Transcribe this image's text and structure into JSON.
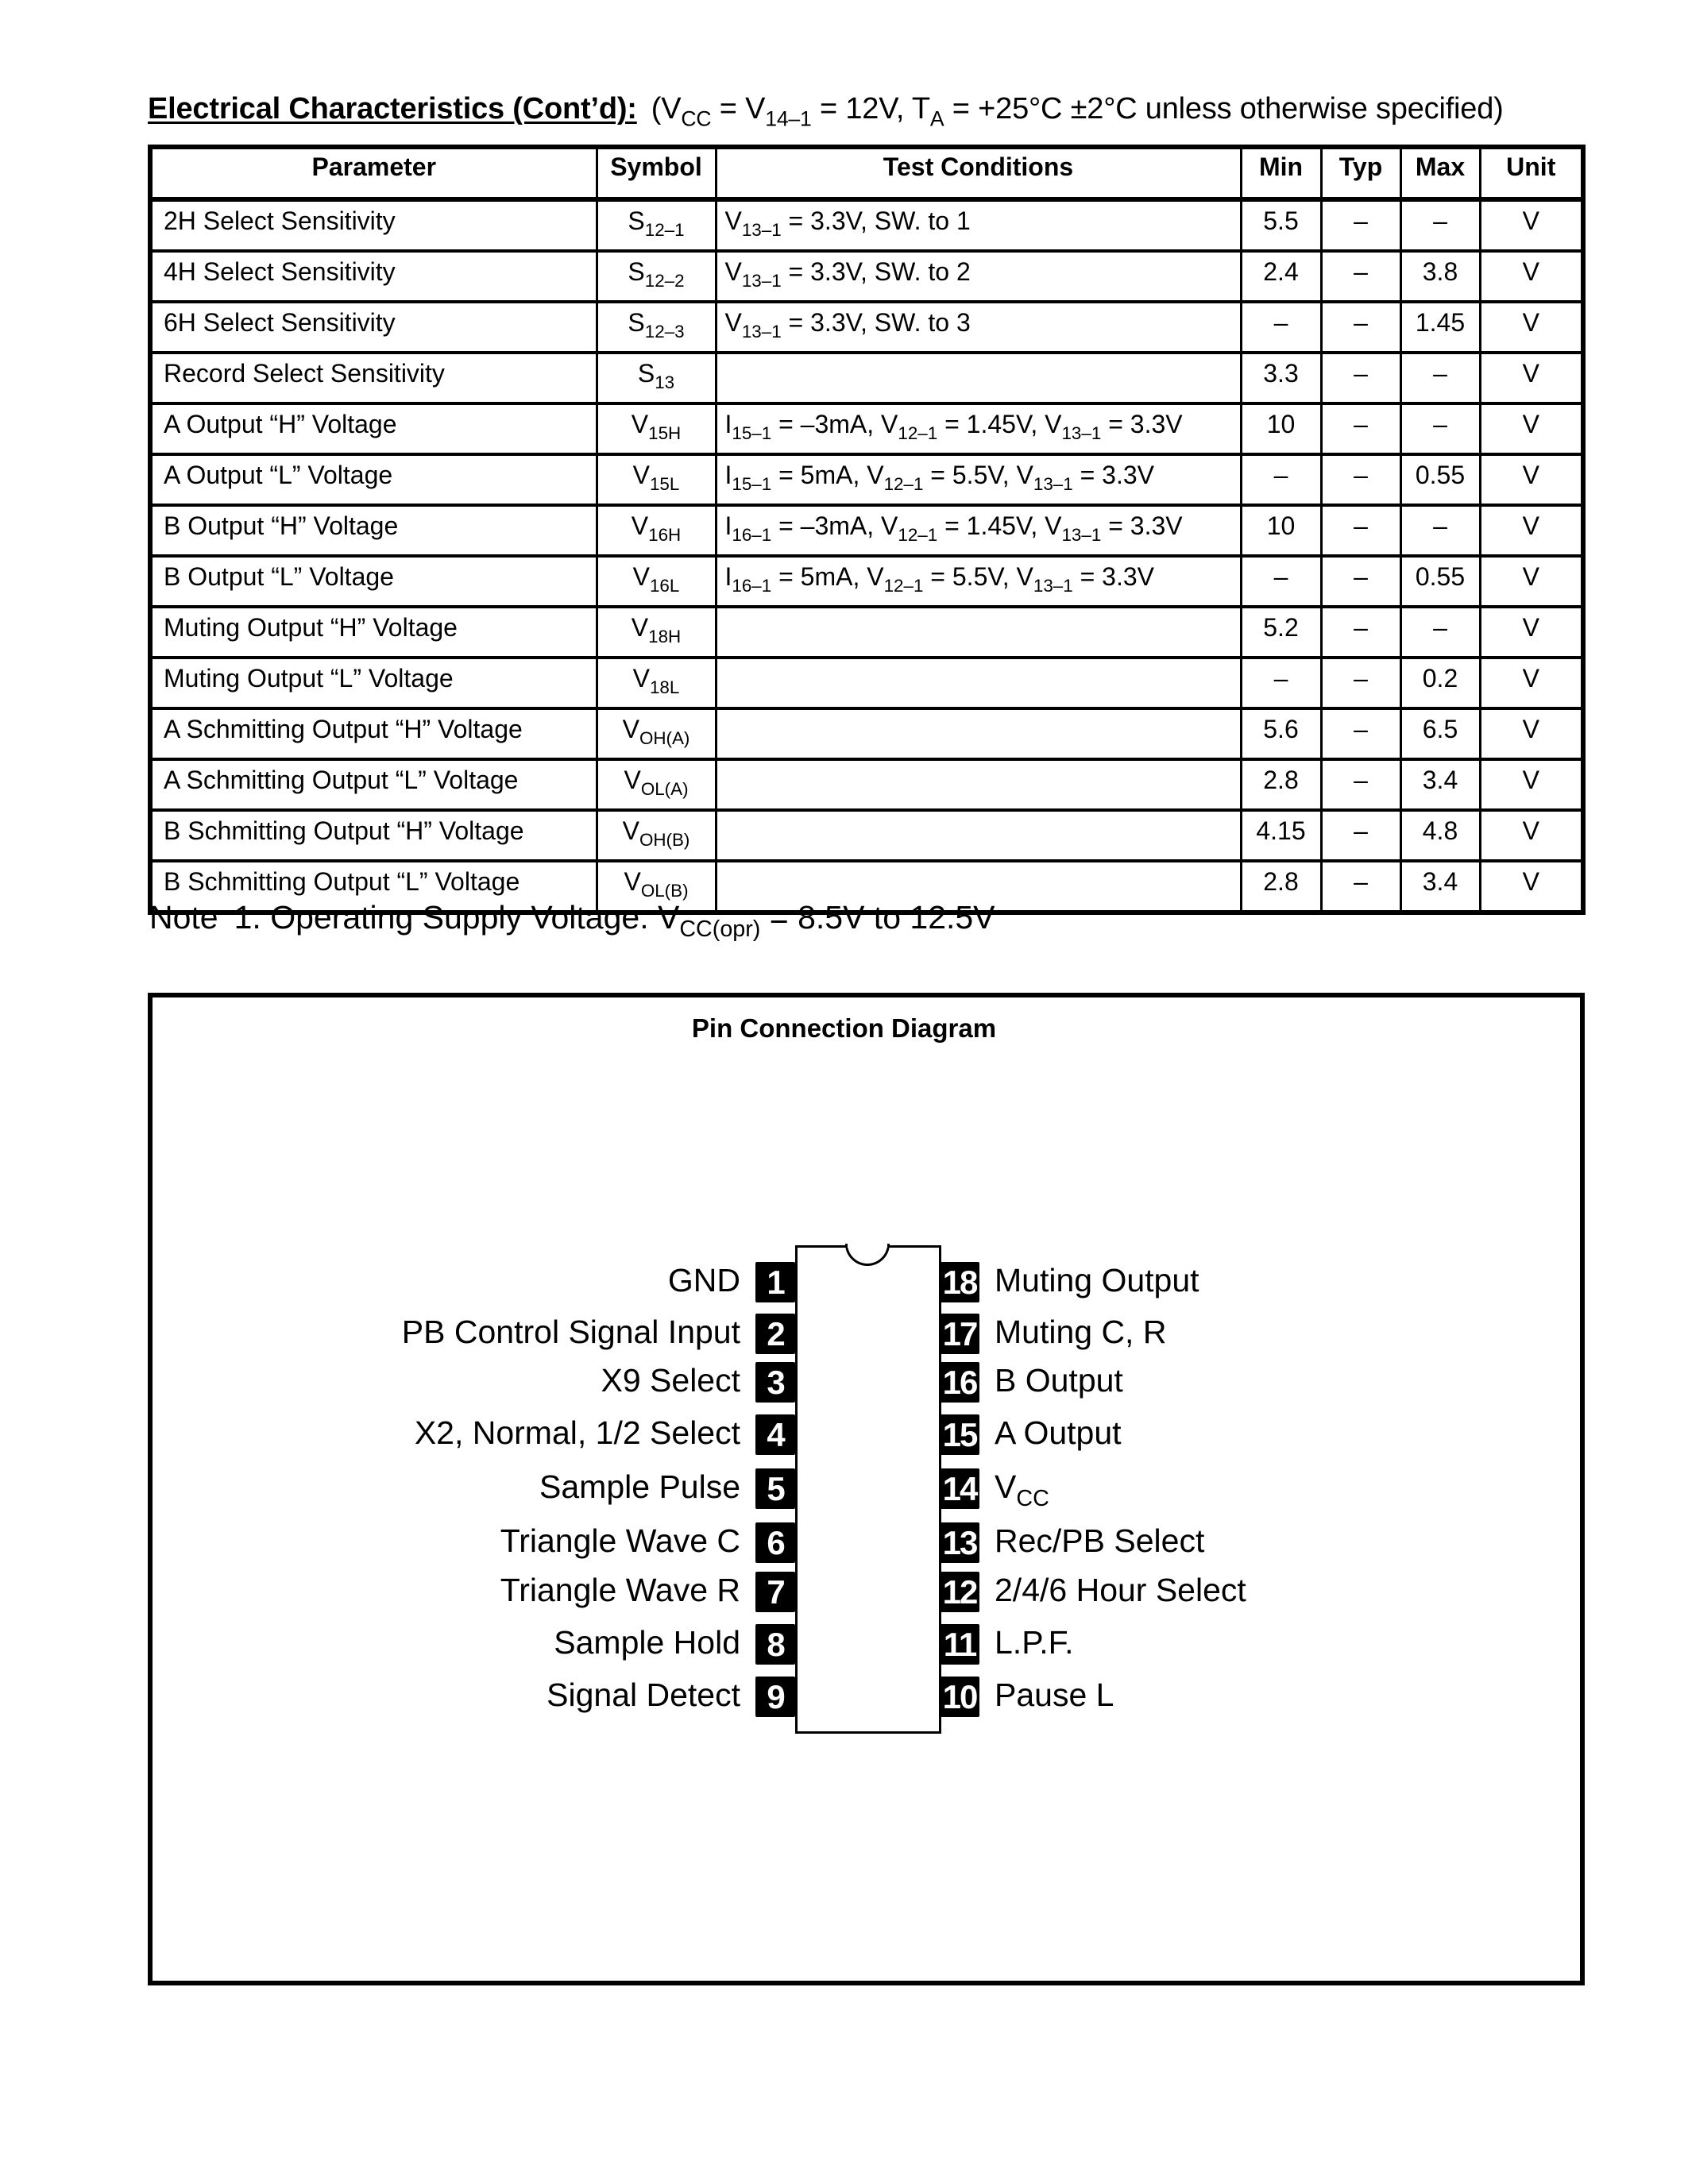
{
  "header": {
    "title": "Electrical Characteristics (Cont’d):",
    "conditions": {
      "prefix": "(V",
      "vcc_sub": "CC",
      "mid1": " = V",
      "v_sub": "14–1",
      "mid2": " = 12V, T",
      "t_sub": "A",
      "suffix": " = +25°C ±2°C unless otherwise specified)"
    }
  },
  "table": {
    "columns": [
      "Parameter",
      "Symbol",
      "Test Conditions",
      "Min",
      "Typ",
      "Max",
      "Unit"
    ],
    "rows": [
      {
        "parameter": "2H Select Sensitivity",
        "symbol": {
          "base": "S",
          "sub": "12–1"
        },
        "conditions": [
          {
            "t": "V"
          },
          {
            "s": "13–1"
          },
          {
            "t": " = 3.3V, SW. to 1"
          }
        ],
        "min": "5.5",
        "typ": "–",
        "max": "–",
        "unit": "V"
      },
      {
        "parameter": "4H Select Sensitivity",
        "symbol": {
          "base": "S",
          "sub": "12–2"
        },
        "conditions": [
          {
            "t": "V"
          },
          {
            "s": "13–1"
          },
          {
            "t": " = 3.3V, SW. to 2"
          }
        ],
        "min": "2.4",
        "typ": "–",
        "max": "3.8",
        "unit": "V"
      },
      {
        "parameter": "6H Select Sensitivity",
        "symbol": {
          "base": "S",
          "sub": "12–3"
        },
        "conditions": [
          {
            "t": "V"
          },
          {
            "s": "13–1"
          },
          {
            "t": " = 3.3V, SW. to 3"
          }
        ],
        "min": "–",
        "typ": "–",
        "max": "1.45",
        "unit": "V"
      },
      {
        "parameter": "Record Select Sensitivity",
        "symbol": {
          "base": "S",
          "sub": "13"
        },
        "conditions": [],
        "min": "3.3",
        "typ": "–",
        "max": "–",
        "unit": "V"
      },
      {
        "parameter": "A Output “H” Voltage",
        "symbol": {
          "base": "V",
          "sub": "15H"
        },
        "conditions": [
          {
            "t": "I"
          },
          {
            "s": "15–1"
          },
          {
            "t": " = –3mA, V"
          },
          {
            "s": "12–1"
          },
          {
            "t": " = 1.45V, V"
          },
          {
            "s": "13–1"
          },
          {
            "t": " = 3.3V"
          }
        ],
        "min": "10",
        "typ": "–",
        "max": "–",
        "unit": "V"
      },
      {
        "parameter": "A Output “L” Voltage",
        "symbol": {
          "base": "V",
          "sub": "15L"
        },
        "conditions": [
          {
            "t": "I"
          },
          {
            "s": "15–1"
          },
          {
            "t": " = 5mA, V"
          },
          {
            "s": "12–1"
          },
          {
            "t": " = 5.5V, V"
          },
          {
            "s": "13–1"
          },
          {
            "t": " = 3.3V"
          }
        ],
        "min": "–",
        "typ": "–",
        "max": "0.55",
        "unit": "V"
      },
      {
        "parameter": "B Output “H” Voltage",
        "symbol": {
          "base": "V",
          "sub": "16H"
        },
        "conditions": [
          {
            "t": "I"
          },
          {
            "s": "16–1"
          },
          {
            "t": " = –3mA, V"
          },
          {
            "s": "12–1"
          },
          {
            "t": " = 1.45V, V"
          },
          {
            "s": "13–1"
          },
          {
            "t": " = 3.3V"
          }
        ],
        "min": "10",
        "typ": "–",
        "max": "–",
        "unit": "V"
      },
      {
        "parameter": "B Output “L” Voltage",
        "symbol": {
          "base": "V",
          "sub": "16L"
        },
        "conditions": [
          {
            "t": "I"
          },
          {
            "s": "16–1"
          },
          {
            "t": " = 5mA, V"
          },
          {
            "s": "12–1"
          },
          {
            "t": " = 5.5V, V"
          },
          {
            "s": "13–1"
          },
          {
            "t": " = 3.3V"
          }
        ],
        "min": "–",
        "typ": "–",
        "max": "0.55",
        "unit": "V"
      },
      {
        "parameter": "Muting Output “H” Voltage",
        "symbol": {
          "base": "V",
          "sub": "18H"
        },
        "conditions": [],
        "min": "5.2",
        "typ": "–",
        "max": "–",
        "unit": "V"
      },
      {
        "parameter": "Muting Output “L” Voltage",
        "symbol": {
          "base": "V",
          "sub": "18L"
        },
        "conditions": [],
        "min": "–",
        "typ": "–",
        "max": "0.2",
        "unit": "V"
      },
      {
        "parameter": "A Schmitting Output “H” Voltage",
        "symbol": {
          "base": "V",
          "sub": "OH(A)"
        },
        "conditions": [],
        "min": "5.6",
        "typ": "–",
        "max": "6.5",
        "unit": "V"
      },
      {
        "parameter": "A Schmitting Output “L” Voltage",
        "symbol": {
          "base": "V",
          "sub": "OL(A)"
        },
        "conditions": [],
        "min": "2.8",
        "typ": "–",
        "max": "3.4",
        "unit": "V"
      },
      {
        "parameter": "B Schmitting Output “H” Voltage",
        "symbol": {
          "base": "V",
          "sub": "OH(B)"
        },
        "conditions": [],
        "min": "4.15",
        "typ": "–",
        "max": "4.8",
        "unit": "V"
      },
      {
        "parameter": "B Schmitting Output “L” Voltage",
        "symbol": {
          "base": "V",
          "sub": "OL(B)"
        },
        "conditions": [],
        "min": "2.8",
        "typ": "–",
        "max": "3.4",
        "unit": "V"
      }
    ]
  },
  "note": {
    "label": "Note",
    "text_prefix": "1. Operating Supply Voltage:  V",
    "sub": "CC(opr)",
    "text_suffix": " = 8.5V to 12.5V"
  },
  "diagram": {
    "title": "Pin Connection Diagram",
    "left_pins": [
      {
        "number": "1",
        "label": "GND"
      },
      {
        "number": "2",
        "label": "PB Control Signal Input"
      },
      {
        "number": "3",
        "label": "X9 Select"
      },
      {
        "number": "4",
        "label": "X2, Normal, 1/2 Select"
      },
      {
        "number": "5",
        "label": "Sample Pulse"
      },
      {
        "number": "6",
        "label": "Triangle Wave C"
      },
      {
        "number": "7",
        "label": "Triangle Wave R"
      },
      {
        "number": "8",
        "label": "Sample Hold"
      },
      {
        "number": "9",
        "label": "Signal Detect"
      }
    ],
    "right_pins": [
      {
        "number": "18",
        "label": "Muting Output"
      },
      {
        "number": "17",
        "label": "Muting C, R"
      },
      {
        "number": "16",
        "label": "B Output"
      },
      {
        "number": "15",
        "label": "A Output"
      },
      {
        "number": "14",
        "label": "V",
        "sub": "CC"
      },
      {
        "number": "13",
        "label": "Rec/PB Select"
      },
      {
        "number": "12",
        "label": "2/4/6 Hour Select"
      },
      {
        "number": "11",
        "label": "L.P.F."
      },
      {
        "number": "10",
        "label": "Pause L"
      }
    ]
  }
}
